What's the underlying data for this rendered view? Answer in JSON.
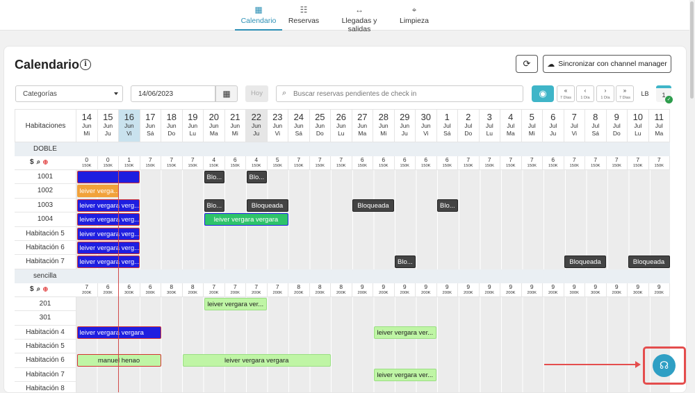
{
  "nav": {
    "items": [
      {
        "label": "Calendario",
        "icon": "calendar-icon",
        "glyph": "▦"
      },
      {
        "label": "Reservas",
        "icon": "list-icon",
        "glyph": "☷"
      },
      {
        "label": "Llegadas y salidas",
        "icon": "arrows-icon",
        "glyph": "↔"
      },
      {
        "label": "Limpieza",
        "icon": "broom-icon",
        "glyph": "⌖"
      }
    ]
  },
  "page": {
    "title": "Calendario"
  },
  "toolbar": {
    "refresh_icon": "refresh-icon",
    "sync_label": "Sincronizar con channel manager",
    "category_label": "Categorías",
    "date_value": "14/06/2023",
    "hoy_label": "Hoy",
    "search_placeholder": "Buscar reservas pendientes de check in",
    "nav": [
      {
        "label": "«",
        "sub": "7 Días"
      },
      {
        "label": "‹",
        "sub": "1 Día"
      },
      {
        "label": "›",
        "sub": "1 Día"
      },
      {
        "label": "»",
        "sub": "7 Días"
      }
    ],
    "lb_label": "LB",
    "count_label": "1"
  },
  "grid": {
    "header_label": "Habitaciones",
    "days": [
      {
        "n": "14",
        "m": "Jun",
        "w": "Mi"
      },
      {
        "n": "15",
        "m": "Jun",
        "w": "Ju"
      },
      {
        "n": "16",
        "m": "Jun",
        "w": "Vi"
      },
      {
        "n": "17",
        "m": "Jun",
        "w": "Sá"
      },
      {
        "n": "18",
        "m": "Jun",
        "w": "Do"
      },
      {
        "n": "19",
        "m": "Jun",
        "w": "Lu"
      },
      {
        "n": "20",
        "m": "Jun",
        "w": "Ma"
      },
      {
        "n": "21",
        "m": "Jun",
        "w": "Mi"
      },
      {
        "n": "22",
        "m": "Jun",
        "w": "Ju"
      },
      {
        "n": "23",
        "m": "Jun",
        "w": "Vi"
      },
      {
        "n": "24",
        "m": "Jun",
        "w": "Sá"
      },
      {
        "n": "25",
        "m": "Jun",
        "w": "Do"
      },
      {
        "n": "26",
        "m": "Jun",
        "w": "Lu"
      },
      {
        "n": "27",
        "m": "Jun",
        "w": "Ma"
      },
      {
        "n": "28",
        "m": "Jun",
        "w": "Mi"
      },
      {
        "n": "29",
        "m": "Jun",
        "w": "Ju"
      },
      {
        "n": "30",
        "m": "Jun",
        "w": "Vi"
      },
      {
        "n": "1",
        "m": "Jul",
        "w": "Sá"
      },
      {
        "n": "2",
        "m": "Jul",
        "w": "Do"
      },
      {
        "n": "3",
        "m": "Jul",
        "w": "Lu"
      },
      {
        "n": "4",
        "m": "Jul",
        "w": "Ma"
      },
      {
        "n": "5",
        "m": "Jul",
        "w": "Mi"
      },
      {
        "n": "6",
        "m": "Jul",
        "w": "Ju"
      },
      {
        "n": "7",
        "m": "Jul",
        "w": "Vi"
      },
      {
        "n": "8",
        "m": "Jul",
        "w": "Sá"
      },
      {
        "n": "9",
        "m": "Jul",
        "w": "Do"
      },
      {
        "n": "10",
        "m": "Jul",
        "w": "Lu"
      },
      {
        "n": "11",
        "m": "Jul",
        "w": "Ma"
      }
    ],
    "selected_day": 2,
    "highlight_day": 8,
    "sections": [
      {
        "name": "DOBLE",
        "avail": [
          "0",
          "0",
          "1",
          "7",
          "7",
          "7",
          "4",
          "6",
          "4",
          "5",
          "7",
          "7",
          "7",
          "6",
          "6",
          "6",
          "6",
          "6",
          "7",
          "7",
          "7",
          "7",
          "6",
          "7",
          "7",
          "7",
          "7",
          "7"
        ],
        "price": "150K",
        "rooms": [
          {
            "name": "1001",
            "bookings": [
              {
                "start": 0,
                "len": 3,
                "label": "",
                "style": "b-blue"
              },
              {
                "start": 6,
                "len": 1,
                "label": "Blo...",
                "style": "b-block"
              },
              {
                "start": 8,
                "len": 1,
                "label": "Blo...",
                "style": "b-block"
              }
            ]
          },
          {
            "name": "1002",
            "bookings": [
              {
                "start": 0,
                "len": 2,
                "label": "leiver verga...",
                "style": "b-orange"
              }
            ]
          },
          {
            "name": "1003",
            "bookings": [
              {
                "start": 0,
                "len": 3,
                "label": "leiver vergara verg...",
                "style": "b-blue"
              },
              {
                "start": 6,
                "len": 1,
                "label": "Blo...",
                "style": "b-block"
              },
              {
                "start": 8,
                "len": 2,
                "label": "Bloqueada",
                "style": "b-block"
              },
              {
                "start": 13,
                "len": 2,
                "label": "Bloqueada",
                "style": "b-block"
              },
              {
                "start": 17,
                "len": 1,
                "label": "Blo...",
                "style": "b-block"
              }
            ]
          },
          {
            "name": "1004",
            "bookings": [
              {
                "start": 0,
                "len": 3,
                "label": "leiver vergara verg...",
                "style": "b-blue"
              },
              {
                "start": 6,
                "len": 4,
                "label": "leiver vergara vergara",
                "style": "b-green"
              }
            ]
          },
          {
            "name": "Habitación 5",
            "bookings": [
              {
                "start": 0,
                "len": 3,
                "label": "leiver vergara verg...",
                "style": "b-blue"
              }
            ]
          },
          {
            "name": "Habitación 6",
            "bookings": [
              {
                "start": 0,
                "len": 3,
                "label": "leiver vergara verg...",
                "style": "b-blue"
              }
            ]
          },
          {
            "name": "Habitación 7",
            "bookings": [
              {
                "start": 0,
                "len": 3,
                "label": "leiver vergara verg...",
                "style": "b-blue"
              },
              {
                "start": 15,
                "len": 1,
                "label": "Blo...",
                "style": "b-block"
              },
              {
                "start": 23,
                "len": 2,
                "label": "Bloqueada",
                "style": "b-block"
              },
              {
                "start": 26,
                "len": 2,
                "label": "Bloqueada",
                "style": "b-block"
              }
            ]
          }
        ]
      },
      {
        "name": "sencilla",
        "avail": [
          "7",
          "6",
          "6",
          "6",
          "8",
          "8",
          "7",
          "7",
          "7",
          "7",
          "8",
          "8",
          "8",
          "9",
          "9",
          "9",
          "9",
          "9",
          "9",
          "9",
          "9",
          "9",
          "9",
          "9",
          "9",
          "9",
          "9",
          "9"
        ],
        "price": "200K",
        "price_by_day": [
          "200K",
          "200K",
          "300K",
          "300K",
          "300K",
          "200K",
          "200K",
          "200K",
          "200K",
          "200K",
          "200K",
          "200K",
          "200K",
          "200K",
          "200K",
          "200K",
          "200K",
          "200K",
          "200K",
          "200K",
          "200K",
          "200K",
          "200K",
          "300K",
          "300K",
          "200K",
          "300K",
          "200K"
        ],
        "rooms": [
          {
            "name": "201",
            "bookings": [
              {
                "start": 6,
                "len": 3,
                "label": "leiver vergara ver...",
                "style": "b-lgreen"
              }
            ]
          },
          {
            "name": "301",
            "bookings": []
          },
          {
            "name": "Habitación 4",
            "bookings": [
              {
                "start": 0,
                "len": 4,
                "label": "leiver vergara vergara",
                "style": "b-blue"
              },
              {
                "start": 14,
                "len": 3,
                "label": "leiver vergara ver...",
                "style": "b-lgreen"
              }
            ]
          },
          {
            "name": "Habitación 5",
            "bookings": []
          },
          {
            "name": "Habitación 6",
            "bookings": [
              {
                "start": 0,
                "len": 4,
                "label": "manuel henao",
                "style": "b-lgreen-red"
              },
              {
                "start": 5,
                "len": 7,
                "label": "leiver vergara vergara",
                "style": "b-lgreen"
              }
            ]
          },
          {
            "name": "Habitación 7",
            "bookings": [
              {
                "start": 14,
                "len": 3,
                "label": "leiver vergara ver...",
                "style": "b-lgreen"
              }
            ]
          },
          {
            "name": "Habitación 8",
            "bookings": []
          }
        ]
      }
    ]
  },
  "support": {
    "icon": "headset-icon"
  }
}
